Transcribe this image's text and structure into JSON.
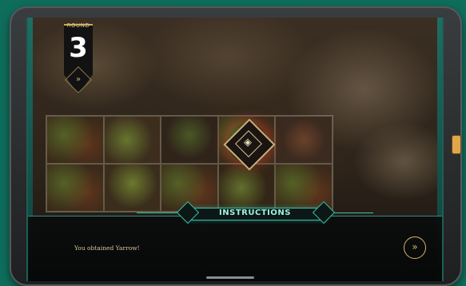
{
  "round": {
    "label": "ROUND",
    "number": "3",
    "next_icon": "»"
  },
  "board": {
    "marker_icon": "eye-icon"
  },
  "instructions": {
    "header": "INSTRUCTIONS",
    "message": "You obtained Yarrow!",
    "next_icon": "»"
  },
  "colors": {
    "accent_teal": "#39c2aa",
    "gold": "#d6b46a",
    "device_bg": "#0f6d5c"
  }
}
